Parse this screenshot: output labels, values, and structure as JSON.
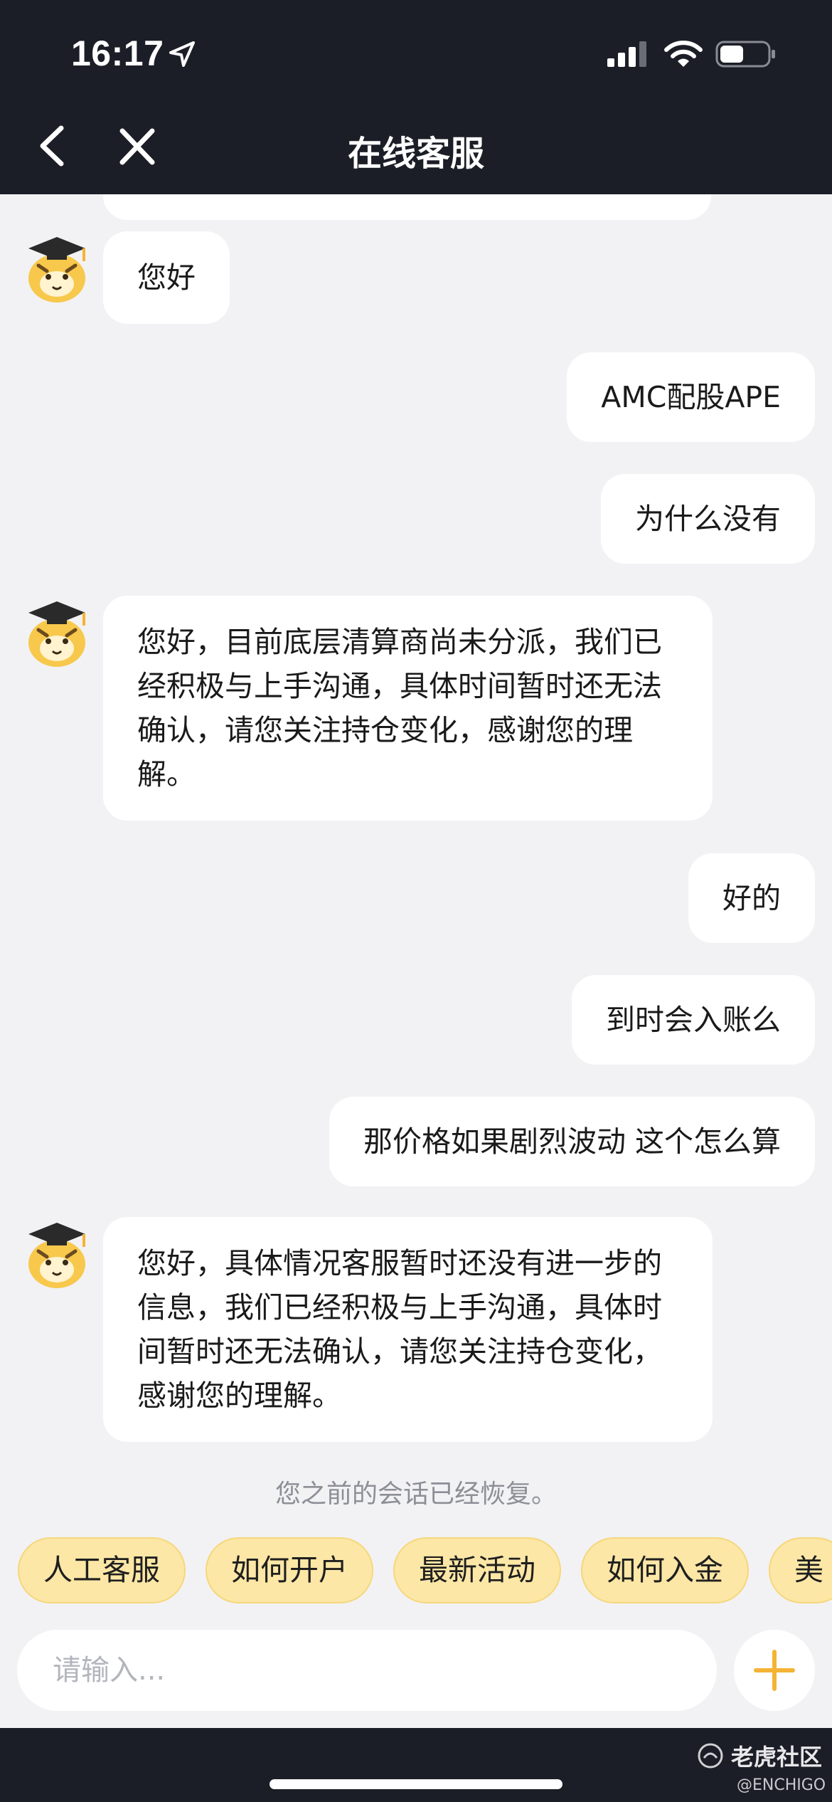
{
  "status_bar": {
    "time": "16:17"
  },
  "header": {
    "title": "在线客服"
  },
  "messages": [
    {
      "from": "agent",
      "text": "您好"
    },
    {
      "from": "user",
      "text": "AMC配股APE"
    },
    {
      "from": "user",
      "text": "为什么没有"
    },
    {
      "from": "agent",
      "text": "您好，目前底层清算商尚未分派，我们已经积极与上手沟通，具体时间暂时还无法确认，请您关注持仓变化，感谢您的理解。"
    },
    {
      "from": "user",
      "text": "好的"
    },
    {
      "from": "user",
      "text": "到时会入账么"
    },
    {
      "from": "user",
      "text": "那价格如果剧烈波动 这个怎么算"
    },
    {
      "from": "agent",
      "text": "您好，具体情况客服暂时还没有进一步的信息，我们已经积极与上手沟通，具体时间暂时还无法确认，请您关注持仓变化，感谢您的理解。"
    }
  ],
  "notice": "您之前的会话已经恢复。",
  "quick_replies": [
    "人工客服",
    "如何开户",
    "最新活动",
    "如何入金",
    "美"
  ],
  "input": {
    "placeholder": "请输入..."
  },
  "watermark": {
    "name": "老虎社区",
    "handle": "@ENCHIGO"
  },
  "colors": {
    "header_bg": "#1c1e27",
    "chat_bg": "#f2f2f4",
    "chip_bg": "#fce7a6",
    "accent": "#f5b335"
  },
  "icons": {
    "back": "chevron-left-icon",
    "close": "close-icon",
    "plus": "plus-icon",
    "avatar": "tiger-graduate-avatar"
  }
}
